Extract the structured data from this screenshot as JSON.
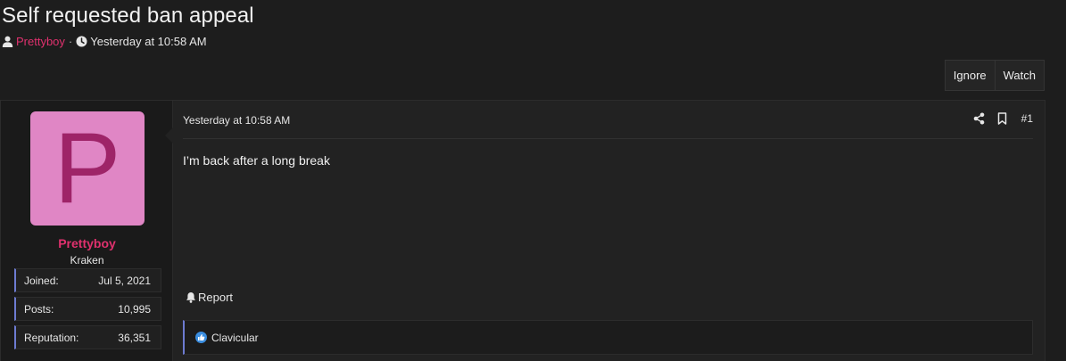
{
  "thread": {
    "title": "Self requested ban appeal",
    "author": "Prettyboy",
    "separator": "·",
    "date": "Yesterday at 10:58 AM"
  },
  "actions": {
    "ignore_label": "Ignore",
    "watch_label": "Watch"
  },
  "user": {
    "avatar_letter": "P",
    "avatar_color": "#e086c5",
    "name": "Prettyboy",
    "name_color": "#e0316e",
    "title": "Kraken",
    "stats": [
      {
        "label": "Joined:",
        "value": "Jul 5, 2021"
      },
      {
        "label": "Posts:",
        "value": "10,995"
      },
      {
        "label": "Reputation:",
        "value": "36,351"
      }
    ]
  },
  "post": {
    "date": "Yesterday at 10:58 AM",
    "number": "#1",
    "body": "I’m back after a long break",
    "report_label": "Report",
    "reactions": {
      "icon": "like-icon",
      "names": "Clavicular"
    }
  }
}
